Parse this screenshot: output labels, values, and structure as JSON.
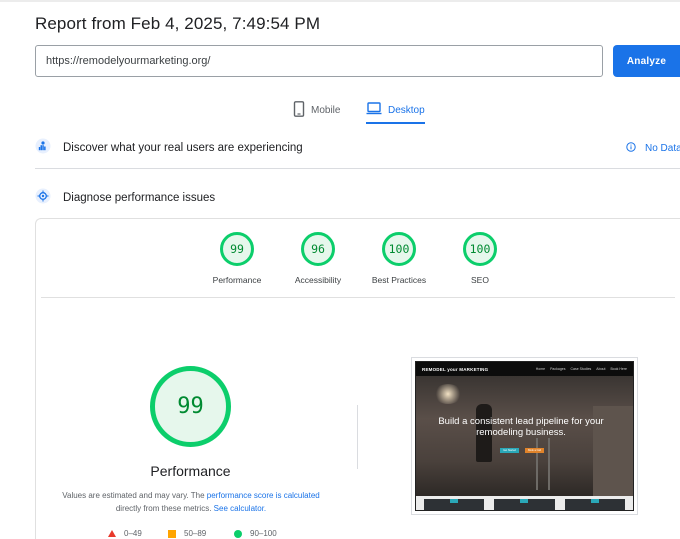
{
  "report": {
    "title": "Report from Feb 4, 2025, 7:49:54 PM",
    "url_value": "https://remodelyourmarketing.org/",
    "analyze_label": "Analyze"
  },
  "device_tabs": [
    {
      "label": "Mobile",
      "selected": false,
      "icon": "smartphone-icon"
    },
    {
      "label": "Desktop",
      "selected": true,
      "icon": "laptop-icon"
    }
  ],
  "sections": {
    "real_users": {
      "label": "Discover what your real users are experiencing",
      "icon": "users-icon",
      "status": "No Data",
      "status_icon": "info-icon"
    },
    "diagnose": {
      "label": "Diagnose performance issues",
      "icon": "lab-icon"
    }
  },
  "scores": [
    {
      "label": "Performance",
      "value": "99"
    },
    {
      "label": "Accessibility",
      "value": "96"
    },
    {
      "label": "Best Practices",
      "value": "100"
    },
    {
      "label": "SEO",
      "value": "100"
    }
  ],
  "main_score": {
    "value": "99",
    "label": "Performance"
  },
  "note": {
    "prefix": "Values are estimated and may vary. The ",
    "link1": "performance score is calculated",
    "middle": " directly from these metrics. ",
    "link2": "See calculator."
  },
  "legend": [
    {
      "range": "0–49",
      "shape": "triangle",
      "color": "#e8382a"
    },
    {
      "range": "50–89",
      "shape": "square",
      "color": "#ffa400"
    },
    {
      "range": "90–100",
      "shape": "circle",
      "color": "#0cce6b"
    }
  ],
  "screenshot": {
    "logo": "REMODEL your MARKETING",
    "nav": [
      "Home",
      "Packages",
      "Case Studies",
      "About",
      "Book Here"
    ],
    "headline": "Build a consistent lead pipeline for your remodeling business.",
    "buttons": [
      "Get Started",
      "Book a Call"
    ]
  },
  "colors": {
    "accent": "#1a73e8",
    "pass": "#0cce6b",
    "pass_text": "#008a31"
  }
}
